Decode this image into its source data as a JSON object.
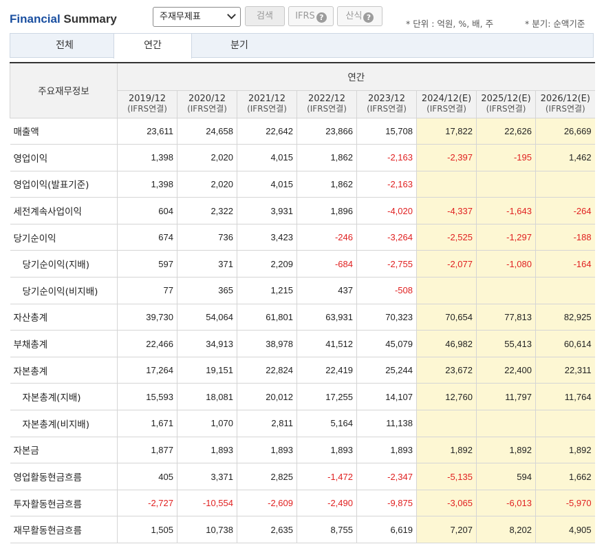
{
  "header": {
    "title_part1": "Financial",
    "title_part2": " Summary",
    "select_value": "주재무제표",
    "search_label": "검색",
    "ifrs_label": "IFRS",
    "formula_label": "산식",
    "help_glyph": "?",
    "unit_note": "* 단위 : 억원, %, 배, 주",
    "period_note": "* 분기: 순액기준"
  },
  "tabs": [
    {
      "label": "전체",
      "active": false
    },
    {
      "label": "연간",
      "active": true
    },
    {
      "label": "분기",
      "active": false
    }
  ],
  "table": {
    "corner_label": "주요재무정보",
    "group_label": "연간",
    "columns": [
      {
        "period": "2019/12",
        "basis": "(IFRS연결)",
        "estimate": false
      },
      {
        "period": "2020/12",
        "basis": "(IFRS연결)",
        "estimate": false
      },
      {
        "period": "2021/12",
        "basis": "(IFRS연결)",
        "estimate": false
      },
      {
        "period": "2022/12",
        "basis": "(IFRS연결)",
        "estimate": false
      },
      {
        "period": "2023/12",
        "basis": "(IFRS연결)",
        "estimate": false
      },
      {
        "period": "2024/12(E)",
        "basis": "(IFRS연결)",
        "estimate": true
      },
      {
        "period": "2025/12(E)",
        "basis": "(IFRS연결)",
        "estimate": true
      },
      {
        "period": "2026/12(E)",
        "basis": "(IFRS연결)",
        "estimate": true
      }
    ],
    "rows": [
      {
        "label": "매출액",
        "indent": false,
        "values": [
          "23,611",
          "24,658",
          "22,642",
          "23,866",
          "15,708",
          "17,822",
          "22,626",
          "26,669"
        ]
      },
      {
        "label": "영업이익",
        "indent": false,
        "values": [
          "1,398",
          "2,020",
          "4,015",
          "1,862",
          "-2,163",
          "-2,397",
          "-195",
          "1,462"
        ]
      },
      {
        "label": "영업이익(발표기준)",
        "indent": false,
        "values": [
          "1,398",
          "2,020",
          "4,015",
          "1,862",
          "-2,163",
          "",
          "",
          ""
        ]
      },
      {
        "label": "세전계속사업이익",
        "indent": false,
        "values": [
          "604",
          "2,322",
          "3,931",
          "1,896",
          "-4,020",
          "-4,337",
          "-1,643",
          "-264"
        ]
      },
      {
        "label": "당기순이익",
        "indent": false,
        "values": [
          "674",
          "736",
          "3,423",
          "-246",
          "-3,264",
          "-2,525",
          "-1,297",
          "-188"
        ]
      },
      {
        "label": "당기순이익(지배)",
        "indent": true,
        "values": [
          "597",
          "371",
          "2,209",
          "-684",
          "-2,755",
          "-2,077",
          "-1,080",
          "-164"
        ]
      },
      {
        "label": "당기순이익(비지배)",
        "indent": true,
        "values": [
          "77",
          "365",
          "1,215",
          "437",
          "-508",
          "",
          "",
          ""
        ]
      },
      {
        "label": "자산총계",
        "indent": false,
        "values": [
          "39,730",
          "54,064",
          "61,801",
          "63,931",
          "70,323",
          "70,654",
          "77,813",
          "82,925"
        ]
      },
      {
        "label": "부채총계",
        "indent": false,
        "values": [
          "22,466",
          "34,913",
          "38,978",
          "41,512",
          "45,079",
          "46,982",
          "55,413",
          "60,614"
        ]
      },
      {
        "label": "자본총계",
        "indent": false,
        "values": [
          "17,264",
          "19,151",
          "22,824",
          "22,419",
          "25,244",
          "23,672",
          "22,400",
          "22,311"
        ]
      },
      {
        "label": "자본총계(지배)",
        "indent": true,
        "values": [
          "15,593",
          "18,081",
          "20,012",
          "17,255",
          "14,107",
          "12,760",
          "11,797",
          "11,764"
        ]
      },
      {
        "label": "자본총계(비지배)",
        "indent": true,
        "values": [
          "1,671",
          "1,070",
          "2,811",
          "5,164",
          "11,138",
          "",
          "",
          ""
        ]
      },
      {
        "label": "자본금",
        "indent": false,
        "values": [
          "1,877",
          "1,893",
          "1,893",
          "1,893",
          "1,893",
          "1,892",
          "1,892",
          "1,892"
        ]
      },
      {
        "label": "영업활동현금흐름",
        "indent": false,
        "values": [
          "405",
          "3,371",
          "2,825",
          "-1,472",
          "-2,347",
          "-5,135",
          "594",
          "1,662"
        ]
      },
      {
        "label": "투자활동현금흐름",
        "indent": false,
        "values": [
          "-2,727",
          "-10,554",
          "-2,609",
          "-2,490",
          "-9,875",
          "-3,065",
          "-6,013",
          "-5,970"
        ]
      },
      {
        "label": "재무활동현금흐름",
        "indent": false,
        "values": [
          "1,505",
          "10,738",
          "2,635",
          "8,755",
          "6,619",
          "7,207",
          "8,202",
          "4,905"
        ]
      }
    ]
  },
  "colors": {
    "accent": "#1a4fa0",
    "negative": "#e02020",
    "estimate_bg": "#fdf7d3"
  }
}
